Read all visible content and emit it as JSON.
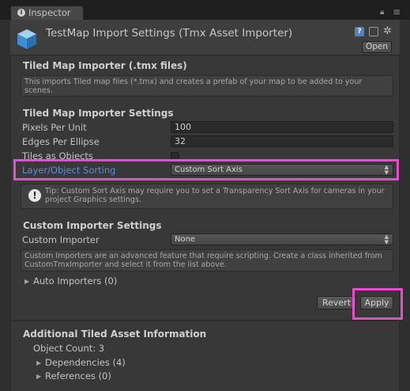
{
  "window": {
    "tab_label": "Inspector",
    "tab_icon": "info-icon"
  },
  "header": {
    "title": "TestMap Import Settings (Tmx Asset Importer)",
    "open_label": "Open",
    "help_icon_glyph": "?",
    "settings_glyph": "✲"
  },
  "tiled_map_importer": {
    "heading": "Tiled Map Importer (.tmx files)",
    "description": "This imports Tiled map files (*.tmx) and creates a prefab of your map to be added to your scenes."
  },
  "settings": {
    "heading": "Tiled Map Importer Settings",
    "pixels_per_unit_label": "Pixels Per Unit",
    "pixels_per_unit_value": "100",
    "edges_per_ellipse_label": "Edges Per Ellipse",
    "edges_per_ellipse_value": "32",
    "tiles_as_objects_label": "Tiles as Objects",
    "tiles_as_objects_checked": false,
    "layer_sorting_label": "Layer/Object Sorting",
    "layer_sorting_value": "Custom Sort Axis",
    "tip": "Tip: Custom Sort Axis may require you to set a Transparency Sort Axis for cameras in your project Graphics settings.",
    "tip_icon_glyph": "!"
  },
  "custom_importer": {
    "heading": "Custom Importer Settings",
    "label": "Custom Importer",
    "value": "None",
    "description": "Custom Importers are an advanced feature that require scripting. Create a class inherited from CustomTmxImporter and select it from the list above.",
    "auto_importers_label": "Auto Importers (0)"
  },
  "actions": {
    "revert_label": "Revert",
    "apply_label": "Apply"
  },
  "additional": {
    "heading": "Additional Tiled Asset Information",
    "object_count": "Object Count: 3",
    "dependencies": "Dependencies (4)",
    "references": "References (0)"
  },
  "colors": {
    "highlight": "#e84ad0",
    "selected_label": "#5b8fe0",
    "panel_bg": "#383838"
  }
}
